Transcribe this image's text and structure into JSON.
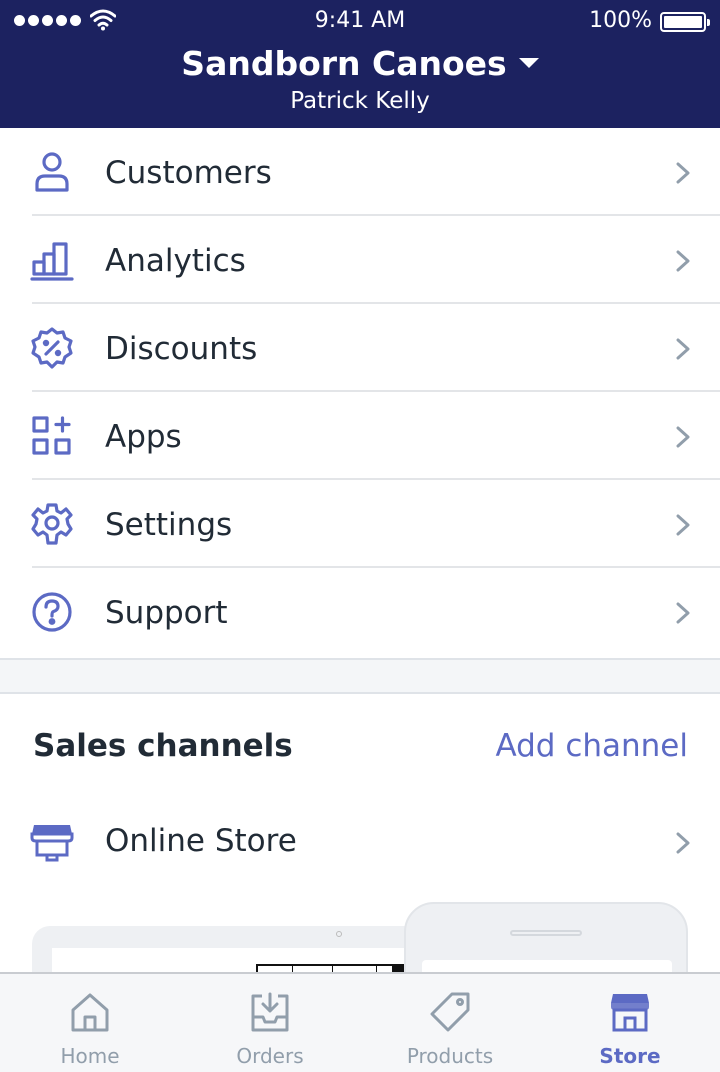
{
  "status_bar": {
    "time": "9:41 AM",
    "battery": "100%"
  },
  "header": {
    "store_name": "Sandborn Canoes",
    "user_name": "Patrick Kelly"
  },
  "menu": {
    "items": [
      {
        "label": "Customers",
        "icon": "customer-icon"
      },
      {
        "label": "Analytics",
        "icon": "analytics-icon"
      },
      {
        "label": "Discounts",
        "icon": "discount-icon"
      },
      {
        "label": "Apps",
        "icon": "apps-icon"
      },
      {
        "label": "Settings",
        "icon": "gear-icon"
      },
      {
        "label": "Support",
        "icon": "question-icon"
      }
    ]
  },
  "sales_channels": {
    "title": "Sales channels",
    "add_label": "Add channel",
    "channels": [
      {
        "label": "Online Store",
        "icon": "storefront-icon"
      }
    ]
  },
  "tabbar": {
    "tabs": [
      {
        "label": "Home",
        "icon": "home-icon"
      },
      {
        "label": "Orders",
        "icon": "orders-icon"
      },
      {
        "label": "Products",
        "icon": "tag-icon"
      },
      {
        "label": "Store",
        "icon": "store-icon",
        "active": true
      }
    ]
  },
  "colors": {
    "header_bg": "#1c2260",
    "accent": "#5c6ac4",
    "text": "#212b36",
    "muted": "#919eab"
  }
}
